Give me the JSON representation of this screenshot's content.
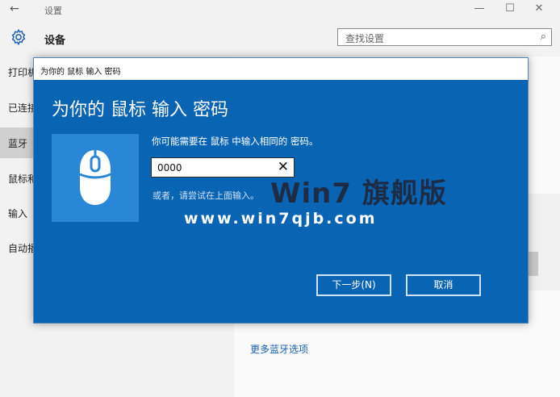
{
  "window": {
    "back_glyph": "←",
    "title": "设置",
    "min_glyph": "—",
    "max_glyph": "☐",
    "close_glyph": "✕"
  },
  "header": {
    "page_title": "设备",
    "search_placeholder": "查找设置",
    "search_glyph": "⌕"
  },
  "sidebar": {
    "items": [
      "打印机",
      "已连接",
      "蓝牙",
      "鼠标和",
      "输入",
      "自动播"
    ]
  },
  "content": {
    "more_bluetooth_options": "更多蓝牙选项"
  },
  "dialog": {
    "titlebar": "为你的 鼠标 输入 密码",
    "heading": "为你的 鼠标 输入 密码",
    "prompt": "你可能需要在 鼠标 中输入相同的 密码。",
    "pin_value": "0000",
    "clear_glyph": "✕",
    "alt_hint": "或者，请尝试在上面输入。",
    "next_label": "下一步(N)",
    "cancel_label": "取消"
  },
  "watermark": {
    "brand": "Win7 旗舰版",
    "url": "www.win7qjb.com"
  },
  "colors": {
    "dialog_bg": "#0a64b4",
    "tile_bg": "#2a86d6",
    "link": "#1a5fb4"
  }
}
